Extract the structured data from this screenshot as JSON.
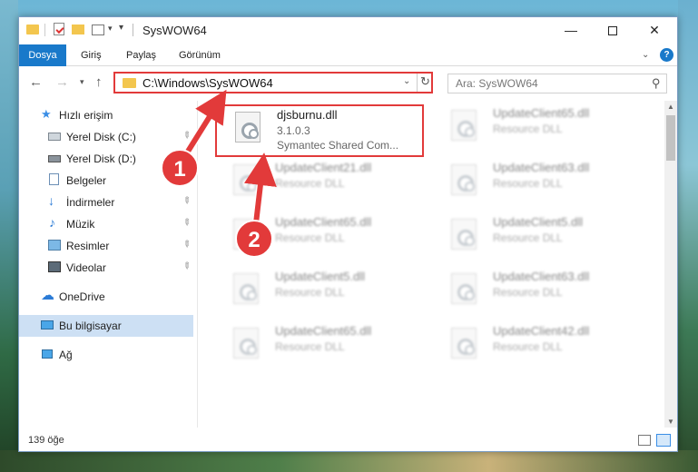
{
  "window": {
    "title": "SysWOW64",
    "controls": {
      "minimize": "—",
      "maximize": "",
      "close": "✕"
    }
  },
  "ribbon": {
    "tabs": [
      "Dosya",
      "Giriş",
      "Paylaş",
      "Görünüm"
    ],
    "help": "?"
  },
  "nav": {
    "address": "C:\\Windows\\SysWOW64",
    "search_placeholder": "Ara: SysWOW64"
  },
  "sidebar": {
    "items": [
      {
        "label": "Hızlı erişim",
        "icon": "star-icon"
      },
      {
        "label": "Yerel Disk (C:)",
        "icon": "disk-icon",
        "pinned": true
      },
      {
        "label": "Yerel Disk (D:)",
        "icon": "disk-icon"
      },
      {
        "label": "Belgeler",
        "icon": "documents-icon",
        "pinned": true
      },
      {
        "label": "İndirmeler",
        "icon": "download-icon",
        "pinned": true
      },
      {
        "label": "Müzik",
        "icon": "music-icon",
        "pinned": true
      },
      {
        "label": "Resimler",
        "icon": "pictures-icon",
        "pinned": true
      },
      {
        "label": "Videolar",
        "icon": "video-icon",
        "pinned": true
      },
      {
        "label": "OneDrive",
        "icon": "cloud-icon"
      },
      {
        "label": "Bu bilgisayar",
        "icon": "computer-icon",
        "selected": true
      },
      {
        "label": "Ağ",
        "icon": "network-icon"
      }
    ]
  },
  "files": [
    {
      "name": "djsburnu.dll",
      "line2": "3.1.0.3",
      "line3": "Symantec Shared Com...",
      "highlighted": true
    },
    {
      "name": "UpdateClient65.dll",
      "line2": "Resource DLL"
    },
    {
      "name": "UpdateClient21.dll",
      "line2": "Resource DLL"
    },
    {
      "name": "UpdateClient63.dll",
      "line2": "Resource DLL"
    },
    {
      "name": "UpdateClient65.dll",
      "line2": "Resource DLL"
    },
    {
      "name": "UpdateClient5.dll",
      "line2": "Resource DLL"
    },
    {
      "name": "UpdateClient5.dll",
      "line2": "Resource DLL"
    },
    {
      "name": "UpdateClient63.dll",
      "line2": "Resource DLL"
    },
    {
      "name": "UpdateClient65.dll",
      "line2": "Resource DLL"
    },
    {
      "name": "UpdateClient42.dll",
      "line2": "Resource DLL"
    }
  ],
  "status": {
    "item_count": "139 öğe"
  },
  "annotations": {
    "step1": "1",
    "step2": "2",
    "color": "#e23a3a"
  }
}
